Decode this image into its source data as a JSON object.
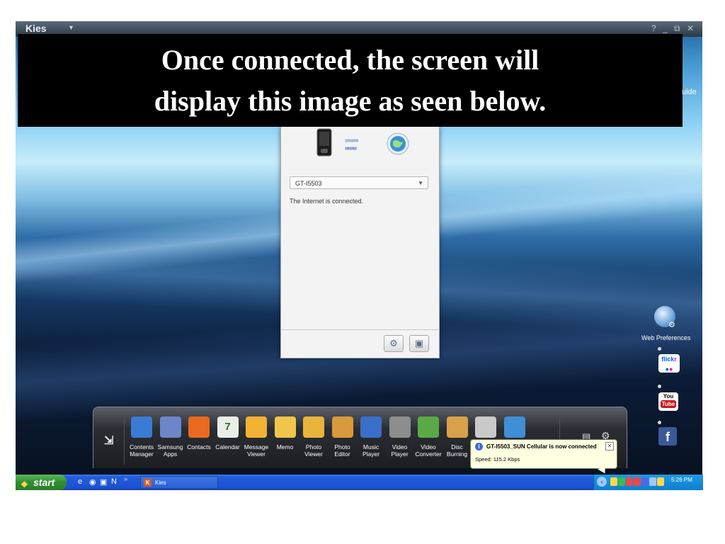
{
  "window": {
    "app_title": "Kies",
    "menu_arrow": "▾",
    "controls": {
      "help": "?",
      "minimize": "_",
      "restore": "⧉",
      "close": "✕"
    }
  },
  "overlay_caption": {
    "line1": "Once connected, the screen will",
    "line2": "display this image as seen below."
  },
  "right_edge_text": "uide",
  "connection_panel": {
    "device_select_value": "GT-I5503",
    "status_text": "The Internet is connected.",
    "arrows_out": "››››››››",
    "arrows_in": "‹‹‹‹‹‹‹",
    "settings_icon": "gear-icon",
    "device_button_icon": "device-info-icon"
  },
  "dock": {
    "items": [
      {
        "label": "Contents\nManager",
        "icon": "contents-manager-icon",
        "color": "#3a7bd5"
      },
      {
        "label": "Samsung\nApps",
        "icon": "samsung-apps-icon",
        "color": "#6d86c9"
      },
      {
        "label": "Contacts",
        "icon": "contacts-icon",
        "color": "#e86a1f"
      },
      {
        "label": "Calendar",
        "icon": "calendar-icon",
        "color": "#e9efe6",
        "glyph": "7"
      },
      {
        "label": "Message\nViewer",
        "icon": "message-viewer-icon",
        "color": "#f2b233"
      },
      {
        "label": "Memo",
        "icon": "memo-icon",
        "color": "#f0c64a"
      },
      {
        "label": "Photo\nViewer",
        "icon": "photo-viewer-icon",
        "color": "#e9b43c"
      },
      {
        "label": "Photo\nEditor",
        "icon": "photo-editor-icon",
        "color": "#d89a3a"
      },
      {
        "label": "Music\nPlayer",
        "icon": "music-player-icon",
        "color": "#3a6fc9"
      },
      {
        "label": "Video\nPlayer",
        "icon": "video-player-icon",
        "color": "#8d8d8d"
      },
      {
        "label": "Video\nConverter",
        "icon": "video-converter-icon",
        "color": "#5aa846"
      },
      {
        "label": "Disc\nBurning",
        "icon": "disc-burning-icon",
        "color": "#d9a24a"
      },
      {
        "label": "",
        "icon": "cd-icon",
        "color": "#c9c9c9"
      },
      {
        "label": "",
        "icon": "globe-icon",
        "color": "#3f8ed6"
      }
    ]
  },
  "notification": {
    "title": "GT-I5503_SUN Cellular is now connected",
    "speed": "Speed: 115.2 Kbps",
    "close": "✕"
  },
  "side_panel": {
    "web_preferences_label": "Web Preferences",
    "flickr_fl": "flick",
    "flickr_r": "r",
    "youtube_top": "You",
    "youtube_bottom": "Tube",
    "facebook": "f"
  },
  "taskbar": {
    "start_label": "start",
    "quick_launch": [
      "e",
      "◉",
      "▣",
      "N"
    ],
    "quick_launch_chevron": "»",
    "task_kies_label": "Kies",
    "task_kies_icon": "K",
    "clock": "5:26 PM",
    "tray_chevron": "‹",
    "tray_colors": [
      "#ffd84a",
      "#3cba54",
      "#e84a4a",
      "#e84a4a",
      "#4a6ae8",
      "#9ecbf5",
      "#ffd84a"
    ]
  }
}
